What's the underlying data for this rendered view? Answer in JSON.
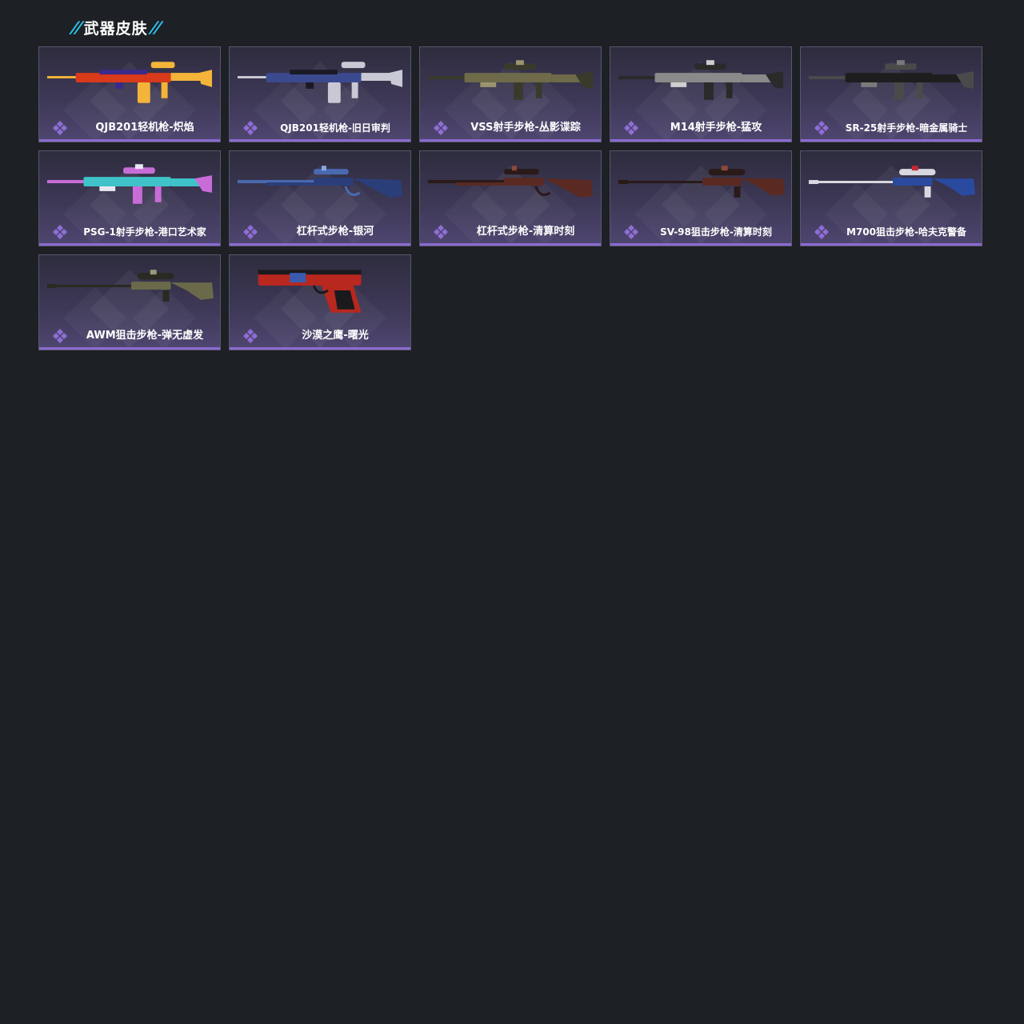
{
  "section": {
    "title": "武器皮肤",
    "slash_left": "//",
    "slash_right": "//",
    "accent_color": "#27c8ee"
  },
  "colors": {
    "background": "#1d2024",
    "card_border": "#5a5670",
    "card_bottom_bar": "#8a6bd1",
    "rarity_icon": "#8f6ed6"
  },
  "skins": [
    {
      "name": "QJB201轻机枪-炽焰",
      "icon": "rarity-diamond-icon",
      "weapon_icon": "light-machine-gun-icon",
      "palette": [
        "#d93a1a",
        "#f4b43a",
        "#3b2a8a"
      ]
    },
    {
      "name": "QJB201轻机枪-旧日审判",
      "icon": "rarity-diamond-icon",
      "weapon_icon": "light-machine-gun-icon",
      "palette": [
        "#3b4a8f",
        "#c9c9d6",
        "#1a1a24"
      ]
    },
    {
      "name": "VSS射手步枪-丛影谍踪",
      "icon": "rarity-diamond-icon",
      "weapon_icon": "marksman-rifle-icon",
      "palette": [
        "#6e6a4a",
        "#3a3a2c",
        "#9a9470"
      ]
    },
    {
      "name": "M14射手步枪-猛攻",
      "icon": "rarity-diamond-icon",
      "weapon_icon": "marksman-rifle-icon",
      "palette": [
        "#8a8a8a",
        "#2a2a2a",
        "#cfcfcf"
      ]
    },
    {
      "name": "SR-25射手步枪-暗金属骑士",
      "icon": "rarity-diamond-icon",
      "weapon_icon": "marksman-rifle-icon",
      "palette": [
        "#1e1e1e",
        "#4a4a4a",
        "#7a7a7a"
      ]
    },
    {
      "name": "PSG-1射手步枪-港口艺术家",
      "icon": "rarity-diamond-icon",
      "weapon_icon": "marksman-rifle-icon",
      "palette": [
        "#3fc3c9",
        "#c86cd8",
        "#e8e8f0"
      ]
    },
    {
      "name": "杠杆式步枪-银河",
      "icon": "rarity-diamond-icon",
      "weapon_icon": "lever-action-rifle-icon",
      "palette": [
        "#2a3f7a",
        "#4a6ab0",
        "#8aa6e0"
      ]
    },
    {
      "name": "杠杆式步枪-清算时刻",
      "icon": "rarity-diamond-icon",
      "weapon_icon": "lever-action-rifle-icon",
      "palette": [
        "#5a2a22",
        "#2a1a18",
        "#8a4a3a"
      ]
    },
    {
      "name": "SV-98狙击步枪-清算时刻",
      "icon": "rarity-diamond-icon",
      "weapon_icon": "sniper-rifle-icon",
      "palette": [
        "#5a2a22",
        "#2a1a18",
        "#8a4a3a"
      ]
    },
    {
      "name": "M700狙击步枪-哈夫克警备",
      "icon": "rarity-diamond-icon",
      "weapon_icon": "sniper-rifle-icon",
      "palette": [
        "#2a4aa0",
        "#d8d8e0",
        "#c8283a"
      ]
    },
    {
      "name": "AWM狙击步枪-弹无虚发",
      "icon": "rarity-diamond-icon",
      "weapon_icon": "sniper-rifle-icon",
      "palette": [
        "#6a6a4a",
        "#2a2a22",
        "#9a9a78"
      ]
    },
    {
      "name": "沙漠之鹰-曙光",
      "icon": "rarity-diamond-icon",
      "weapon_icon": "pistol-icon",
      "palette": [
        "#b8281e",
        "#1a1a1e",
        "#3a5ab0"
      ]
    }
  ]
}
